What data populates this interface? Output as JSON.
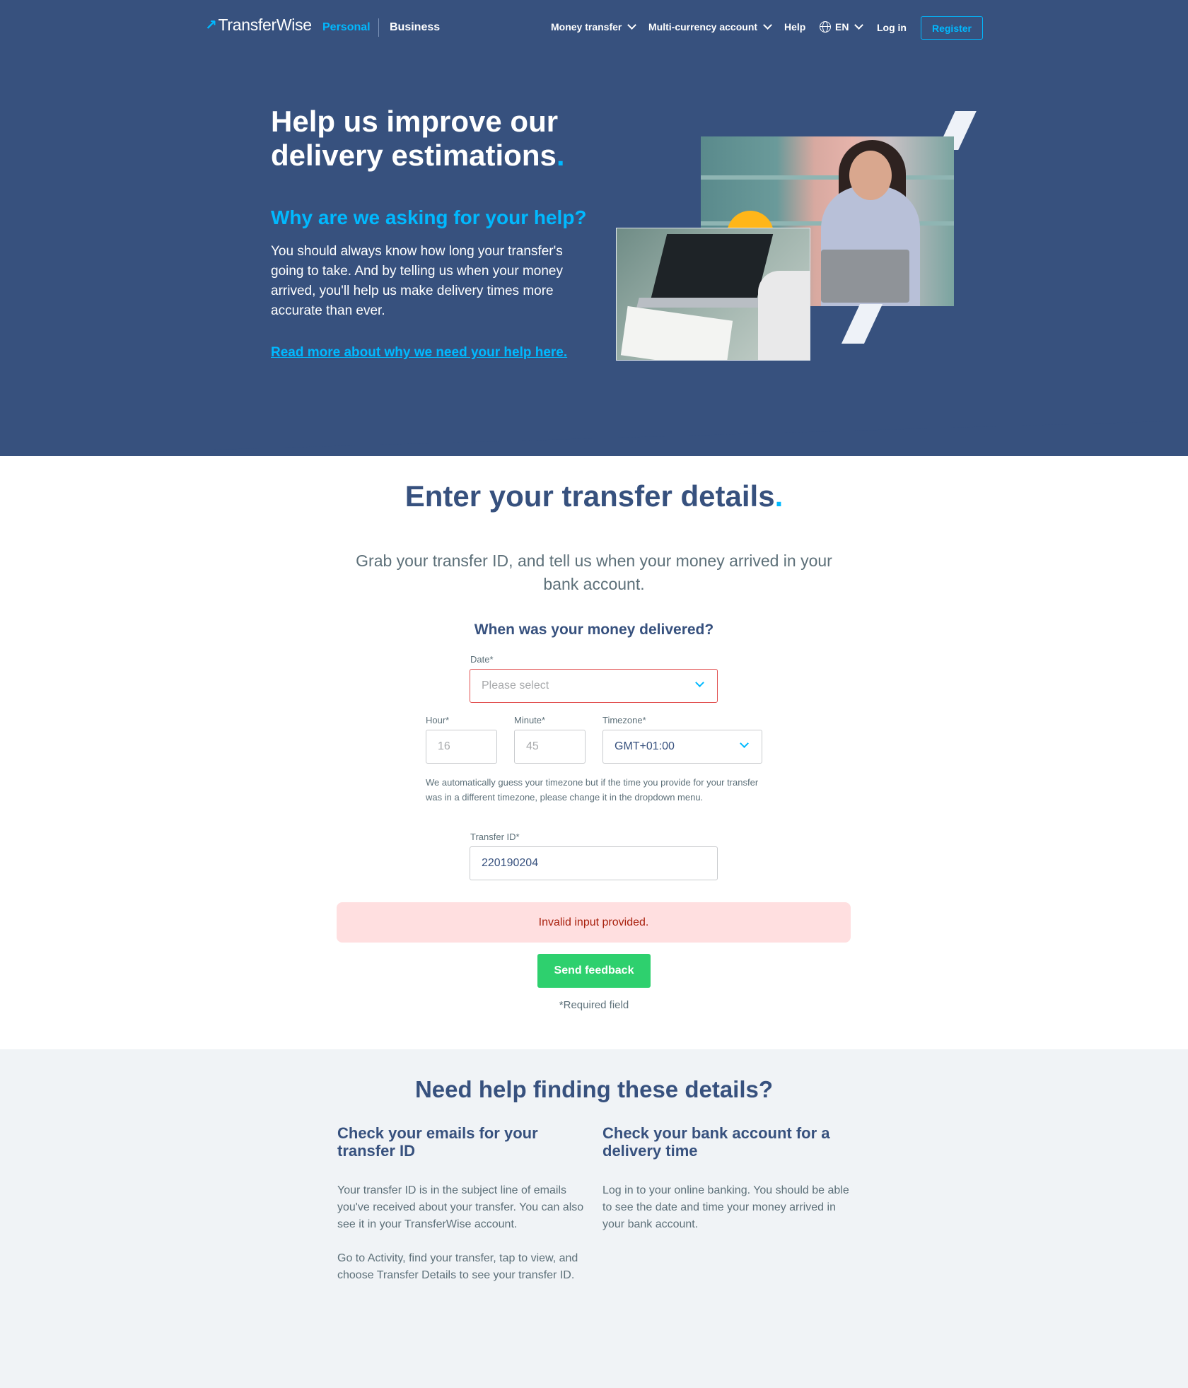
{
  "nav": {
    "logo_mark": "↗",
    "logo_text": "TransferWise",
    "personal": "Personal",
    "business": "Business",
    "money_transfer": "Money transfer",
    "multi_currency": "Multi-currency account",
    "help": "Help",
    "language": "EN",
    "login": "Log in",
    "register": "Register"
  },
  "hero": {
    "title_line1": "Help us improve our",
    "title_line2": "delivery estimations",
    "title_dot": ".",
    "subtitle": "Why are we asking for your help?",
    "body": "You should always know how long your transfer's going to take. And by telling us when your money arrived, you'll help us make delivery times more accurate than ever.",
    "link": "Read more about why we need your help here."
  },
  "form": {
    "title": "Enter your transfer details",
    "title_dot": ".",
    "intro": "Grab your transfer ID, and tell us when your money arrived in your bank account.",
    "when_title": "When was your money delivered?",
    "date_label": "Date*",
    "date_placeholder": "Please select",
    "hour_label": "Hour*",
    "hour_placeholder": "16",
    "minute_label": "Minute*",
    "minute_placeholder": "45",
    "timezone_label": "Timezone*",
    "timezone_value": "GMT+01:00",
    "timezone_help": "We automatically guess your timezone but if the time you provide for your transfer was in a different timezone, please change it in the dropdown menu.",
    "transfer_id_label": "Transfer ID*",
    "transfer_id_value": "220190204",
    "error": "Invalid input provided.",
    "submit": "Send feedback",
    "required_note": "*Required field"
  },
  "help": {
    "title": "Need help finding these details?",
    "col1_title": "Check your emails for your transfer ID",
    "col1_p1": "Your transfer ID is in the subject line of emails you've received about your transfer. You can also see it in your TransferWise account.",
    "col1_p2": "Go to Activity, find your transfer, tap to view, and choose Transfer Details to see your transfer ID.",
    "col2_title": "Check your bank account for a delivery time",
    "col2_p1": "Log in to your online banking. You should be able to see the date and time your money arrived in your bank account."
  },
  "colors": {
    "navy": "#37517e",
    "accent_blue": "#00b9ff",
    "green": "#2ed06e",
    "error_red": "#e14f4f",
    "alert_bg": "#ffdfe0",
    "help_bg": "#f0f3f6"
  },
  "icons": [
    "transferwise-logo-icon",
    "chevron-down-icon",
    "globe-icon"
  ]
}
